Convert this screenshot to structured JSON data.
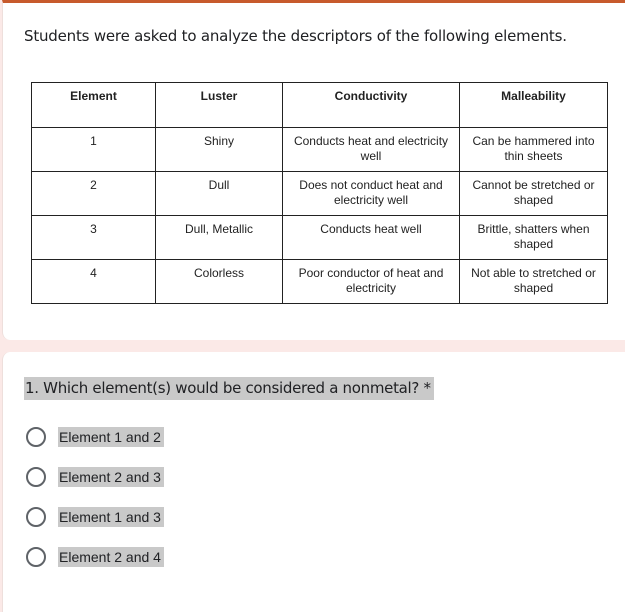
{
  "intro_text": "Students were asked to analyze the descriptors of the following elements.",
  "table": {
    "headers": [
      "Element",
      "Luster",
      "Conductivity",
      "Malleability"
    ],
    "rows": [
      [
        "1",
        "Shiny",
        "Conducts heat and electricity well",
        "Can be hammered into thin sheets"
      ],
      [
        "2",
        "Dull",
        "Does not conduct heat and electricity well",
        "Cannot be stretched or shaped"
      ],
      [
        "3",
        "Dull, Metallic",
        "Conducts heat well",
        "Brittle, shatters when shaped"
      ],
      [
        "4",
        "Colorless",
        "Poor conductor of heat and electricity",
        "Not able to stretched or shaped"
      ]
    ]
  },
  "question": {
    "text": "1. Which element(s) would be considered a nonmetal? *",
    "options": [
      "Element 1 and 2",
      "Element 2 and 3",
      "Element 1 and 3",
      "Element 2 and 4"
    ]
  },
  "colors": {
    "accent": "#c75a2c",
    "background": "#fbe9e7"
  }
}
